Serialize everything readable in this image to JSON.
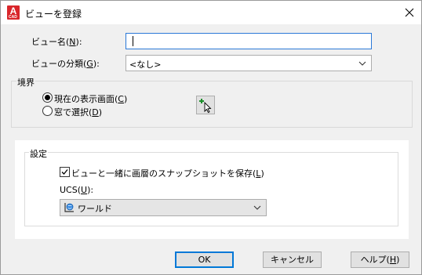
{
  "window": {
    "title": "ビューを登録",
    "icon": "autocad-app-icon",
    "app_icon_letter": "A",
    "app_icon_sub": "CAD"
  },
  "form": {
    "name_label_pre": "ビュー名(",
    "name_label_key": "N",
    "name_label_post": "):",
    "name_value": "",
    "category_label_pre": "ビューの分類(",
    "category_label_key": "G",
    "category_label_post": "):",
    "category_value": "<なし>"
  },
  "boundary": {
    "title": "境界",
    "option1_pre": "現在の表示画面(",
    "option1_key": "C",
    "option1_post": ")",
    "option2_pre": "窓で選択(",
    "option2_key": "D",
    "option2_post": ")",
    "selected": "option1"
  },
  "settings": {
    "title": "設定",
    "save_snapshot_pre": "ビューと一緒に画層のスナップショットを保存(",
    "save_snapshot_key": "L",
    "save_snapshot_post": ")",
    "save_snapshot_checked": true,
    "ucs_label_pre": "UCS(",
    "ucs_label_key": "U",
    "ucs_label_post": "):",
    "ucs_value": "ワールド"
  },
  "buttons": {
    "ok": "OK",
    "cancel": "キャンセル",
    "help_pre": "ヘルプ(",
    "help_key": "H",
    "help_post": ")"
  },
  "colors": {
    "accent": "#0078d7",
    "app_icon": "#d9262b",
    "focus_border": "#2b79d8"
  }
}
